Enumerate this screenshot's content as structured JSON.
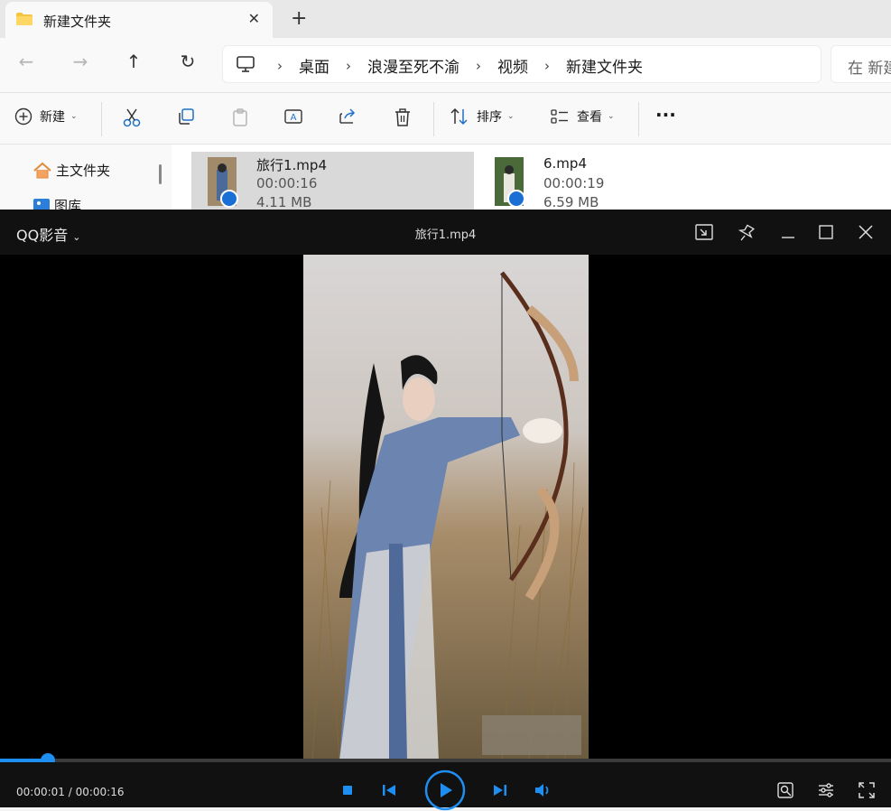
{
  "explorer": {
    "tab_title": "新建文件夹",
    "tab_close": "✕",
    "new_tab": "+",
    "nav": {
      "back": "←",
      "forward": "→",
      "up": "↑",
      "refresh": "↻"
    },
    "breadcrumb": [
      "桌面",
      "浪漫至死不渝",
      "视频",
      "新建文件夹"
    ],
    "breadcrumb_sep": "›",
    "search_placeholder": "在 新建",
    "commands": {
      "new": "新建",
      "sort": "排序",
      "view": "查看",
      "more": "···"
    },
    "nav_pane": [
      "主文件夹",
      "图库"
    ],
    "files": [
      {
        "name": "旅行1.mp4",
        "duration": "00:00:16",
        "size": "4.11 MB",
        "selected": true
      },
      {
        "name": "6.mp4",
        "duration": "00:00:19",
        "size": "6.59 MB",
        "selected": false
      }
    ]
  },
  "player": {
    "brand": "QQ影音",
    "title": "旅行1.mp4",
    "current_time": "00:00:01",
    "total_time": "00:00:16",
    "time_display": "00:00:01 / 00:00:16",
    "progress": 0.054,
    "accent": "#1f8ef1"
  }
}
